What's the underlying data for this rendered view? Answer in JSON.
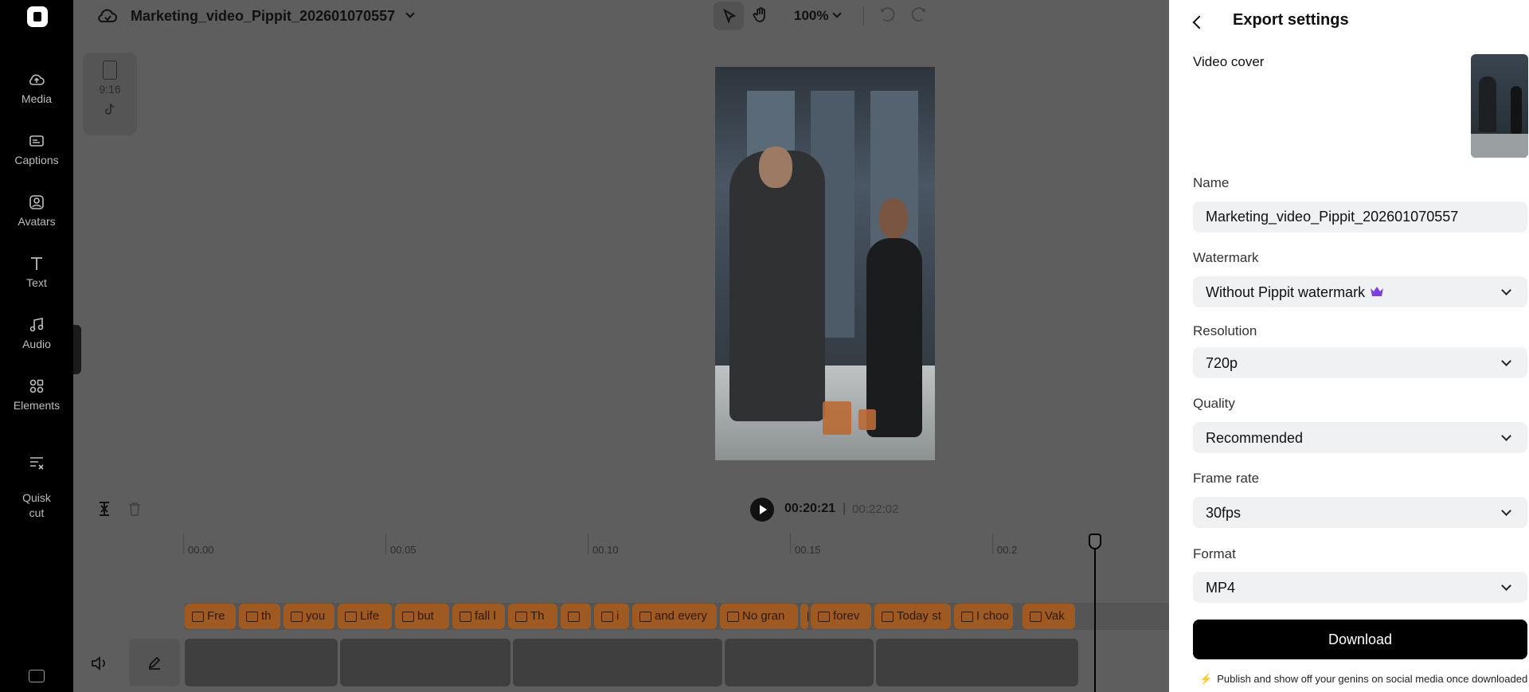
{
  "project": {
    "title": "Marketing_video_Pippit_202601070557"
  },
  "toolbar": {
    "zoom": "100%"
  },
  "sidebar": {
    "items": [
      {
        "label": "Media",
        "icon": "cloud-upload-icon"
      },
      {
        "label": "Captions",
        "icon": "captions-icon"
      },
      {
        "label": "Avatars",
        "icon": "avatar-icon"
      },
      {
        "label": "Text",
        "icon": "text-icon"
      },
      {
        "label": "Audio",
        "icon": "music-note-icon"
      },
      {
        "label": "Elements",
        "icon": "elements-icon"
      },
      {
        "label": "Quisk\ncut",
        "icon": "quick-cut-icon"
      }
    ]
  },
  "canvas": {
    "aspect_ratio": "9:16",
    "platform_icon": "tiktok-icon"
  },
  "playback": {
    "current_time": "00:20:21",
    "separator": "|",
    "total_time": "00:22:02"
  },
  "timeline": {
    "ruler_labels": [
      "00.00",
      "00.05",
      "00.10",
      "00.15",
      "00.2"
    ],
    "caption_chips": [
      "Fre",
      "th",
      "you",
      "Life",
      "but",
      "fall l",
      "Th",
      "",
      "i",
      "and every",
      "No gran",
      "",
      "forev",
      "Today st",
      "I choo",
      "Vak"
    ]
  },
  "export_panel": {
    "title": "Export settings",
    "video_cover_label": "Video cover",
    "name_label": "Name",
    "name_value": "Marketing_video_Pippit_202601070557",
    "watermark_label": "Watermark",
    "watermark_value": "Without Pippit watermark",
    "resolution_label": "Resolution",
    "resolution_value": "720p",
    "quality_label": "Quality",
    "quality_value": "Recommended",
    "frame_rate_label": "Frame rate",
    "frame_rate_value": "30fps",
    "format_label": "Format",
    "format_value": "MP4",
    "download_label": "Download",
    "tip": "Publish and show off your genins on social media once downloaded"
  },
  "colors": {
    "accent": "#000000",
    "caption_chip": "#9f5a22",
    "premium_crown": "#7b3fe4",
    "tip_bolt": "#f5b400"
  }
}
